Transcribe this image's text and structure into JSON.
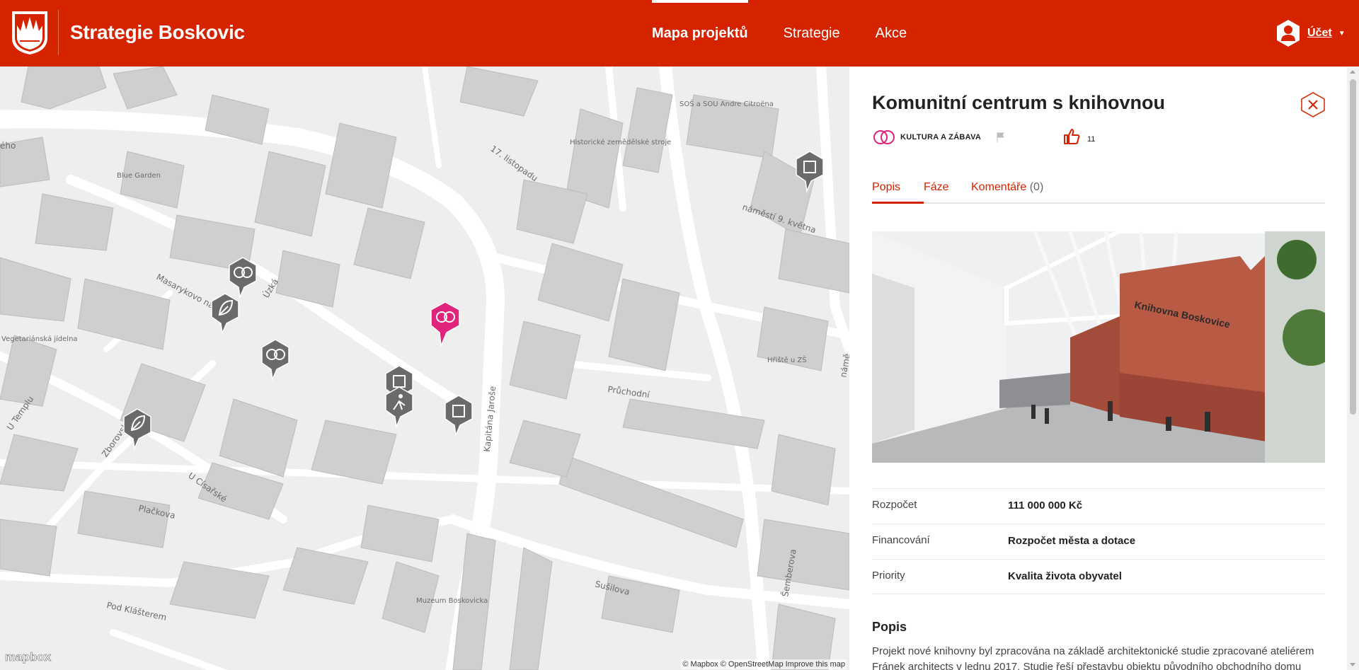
{
  "header": {
    "brand": "Strategie Boskovic",
    "nav": [
      {
        "label": "Mapa projektů"
      },
      {
        "label": "Strategie"
      },
      {
        "label": "Akce"
      }
    ],
    "account_label": "Účet",
    "accent": "#d52300"
  },
  "map": {
    "street_labels": [
      "Masarykovo nám.",
      "Úzká",
      "17. listopadu",
      "náměstí 9. května",
      "Průchodní",
      "Kapitána Jaroše",
      "Plačkova",
      "U Císařské",
      "Zborovská",
      "U Templu",
      "Sušilova",
      "Šemberova",
      "Pod Klášterem",
      "Blue Garden",
      "Vegetariánská jídelna",
      "SOŠ a SOU Andre Citroëna",
      "Historické zemědělské stroje",
      "Hřiště u ZŠ",
      "Muzeum Boskovicka",
      "ého",
      "námě"
    ],
    "logo": "mapbox",
    "attribution": "© Mapbox © OpenStreetMap",
    "improve_link": "Improve this map"
  },
  "panel": {
    "title": "Komunitní centrum s knihovnou",
    "category": "KULTURA A ZÁBAVA",
    "likes": "11",
    "tabs": [
      {
        "label": "Popis"
      },
      {
        "label": "Fáze"
      },
      {
        "label": "Komentáře",
        "count": "(0)"
      }
    ],
    "photo_sign": "Knihovna Boskovice",
    "info": [
      {
        "label": "Rozpočet",
        "value": "111 000 000 Kč"
      },
      {
        "label": "Financování",
        "value": "Rozpočet města a dotace"
      },
      {
        "label": "Priority",
        "value": "Kvalita života obyvatel"
      }
    ],
    "description_title": "Popis",
    "description_text": "Projekt nové knihovny byl zpracována na základě architektonické studie zpracované ateliérem Fránek architects v lednu 2017. Studie řeší přestavbu objektu původního obchodního domu"
  }
}
